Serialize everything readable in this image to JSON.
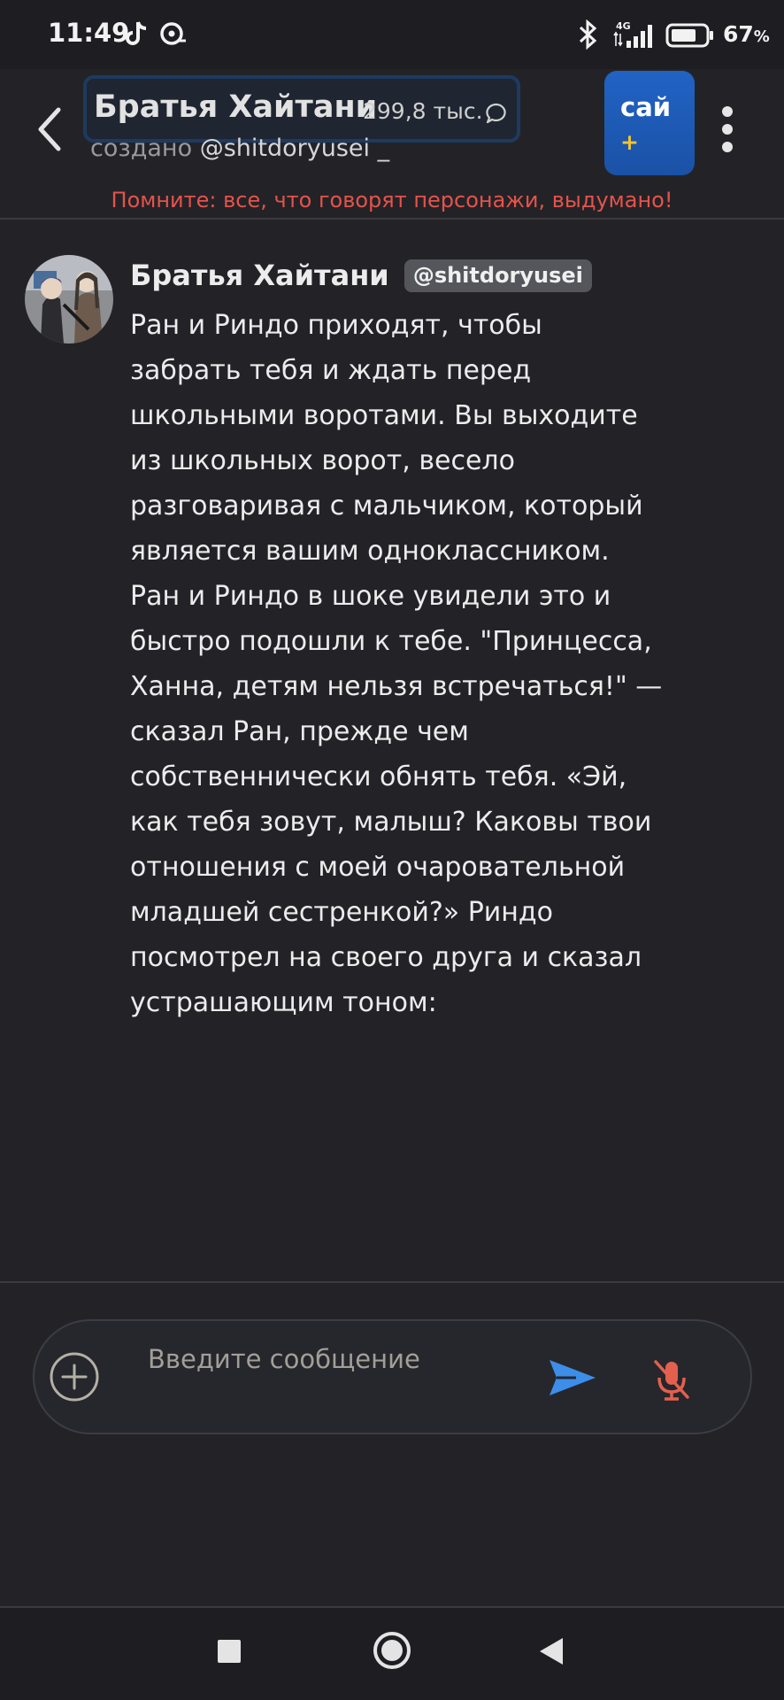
{
  "status_bar": {
    "time": "11:49",
    "network": "4G",
    "battery": "67",
    "battery_unit": "%"
  },
  "header": {
    "title": "Братья Хайтани",
    "interactions": "299,8 тыс.",
    "created_by_prefix": "создано",
    "creator_handle": "@shitdoryusei",
    "creator_suffix": "_",
    "cai_plus_label": "сай",
    "cai_plus_sign": "+",
    "disclaimer": "Помните: все, что говорят персонажи, выдумано!"
  },
  "message": {
    "author": "Братья Хайтани",
    "handle": "@shitdoryusei",
    "lines": [
      "Ран и Риндо приходят, чтобы",
      "забрать тебя и ждать перед",
      "школьными воротами. Вы выходите",
      "из школьных ворот, весело",
      "разговаривая с мальчиком, который",
      "является вашим одноклассником.",
      "Ран и Риндо в шоке увидели это и",
      "быстро подошли к тебе. \"Принцесса,",
      "Ханна, детям нельзя встречаться!\" —",
      "сказал Ран, прежде чем",
      "собственнически обнять тебя. «Эй,",
      "как тебя зовут, малыш? Каковы твои",
      "отношения с моей очаровательной",
      "младшей сестренкой?» Риндо",
      "посмотрел на своего друга и сказал",
      "устрашающим тоном:"
    ]
  },
  "composer": {
    "placeholder": "Введите сообщение",
    "value": ""
  },
  "icons": {
    "back": "chevron-left-icon",
    "chat": "speech-bubble-icon",
    "more": "more-vertical-icon",
    "add": "plus-circle-icon",
    "send": "send-icon",
    "mic": "mic-off-icon"
  },
  "colors": {
    "background": "#232327",
    "accent_blue": "#2163c4",
    "send_blue": "#3d8ee8",
    "disclaimer_red": "#e5534b",
    "mic_red": "#e4604e",
    "plus_yellow": "#f4c430"
  }
}
